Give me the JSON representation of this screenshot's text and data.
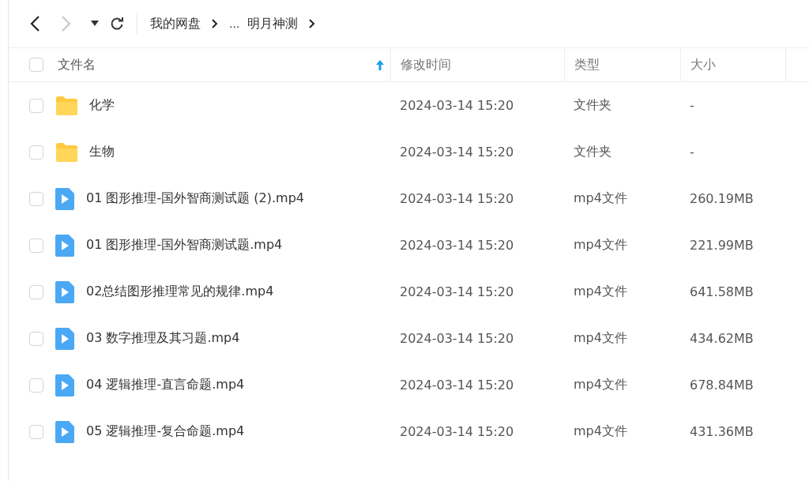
{
  "toolbar": {
    "back": {
      "disabled": false
    },
    "forward": {
      "disabled": true
    },
    "breadcrumb": [
      {
        "label": "我的网盘"
      },
      {
        "label": "..."
      },
      {
        "label": "明月神测"
      }
    ]
  },
  "table": {
    "columns": [
      {
        "label": "文件名",
        "sorted": true
      },
      {
        "label": "修改时间",
        "sorted": false
      },
      {
        "label": "类型",
        "sorted": false
      },
      {
        "label": "大小",
        "sorted": false
      }
    ],
    "select_all": {
      "checked": false
    },
    "rows": [
      {
        "kind": "folder",
        "name": "化学",
        "modified": "2024-03-14 15:20",
        "type": "文件夹",
        "size": "-",
        "checked": false
      },
      {
        "kind": "folder",
        "name": "生物",
        "modified": "2024-03-14 15:20",
        "type": "文件夹",
        "size": "-",
        "checked": false
      },
      {
        "kind": "video",
        "name": "01 图形推理-国外智商测试题 (2).mp4",
        "modified": "2024-03-14 15:20",
        "type": "mp4文件",
        "size": "260.19MB",
        "checked": false
      },
      {
        "kind": "video",
        "name": "01 图形推理-国外智商测试题.mp4",
        "modified": "2024-03-14 15:20",
        "type": "mp4文件",
        "size": "221.99MB",
        "checked": false
      },
      {
        "kind": "video",
        "name": "02总结图形推理常见的规律.mp4",
        "modified": "2024-03-14 15:20",
        "type": "mp4文件",
        "size": "641.58MB",
        "checked": false
      },
      {
        "kind": "video",
        "name": "03 数字推理及其习题.mp4",
        "modified": "2024-03-14 15:20",
        "type": "mp4文件",
        "size": "434.62MB",
        "checked": false
      },
      {
        "kind": "video",
        "name": "04 逻辑推理-直言命题.mp4",
        "modified": "2024-03-14 15:20",
        "type": "mp4文件",
        "size": "678.84MB",
        "checked": false
      },
      {
        "kind": "video",
        "name": "05 逻辑推理-复合命题.mp4",
        "modified": "2024-03-14 15:20",
        "type": "mp4文件",
        "size": "431.36MB",
        "checked": false
      }
    ]
  }
}
